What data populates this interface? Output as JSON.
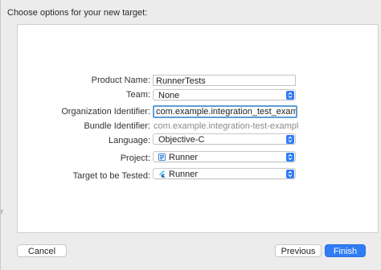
{
  "window": {
    "title": "Choose options for your new target:"
  },
  "form": {
    "product_name": {
      "label": "Product Name:",
      "value": "RunnerTests"
    },
    "team": {
      "label": "Team:",
      "value": "None"
    },
    "org_identifier": {
      "label": "Organization Identifier:",
      "value": "com.example.integration_test_example"
    },
    "bundle_identifier": {
      "label": "Bundle Identifier:",
      "value": "com.example.integration-test-example.RunnerT..."
    },
    "language": {
      "label": "Language:",
      "value": "Objective-C"
    },
    "project": {
      "label": "Project:",
      "value": "Runner",
      "icon": "xcode-project-icon"
    },
    "target_to_test": {
      "label": "Target to be Tested:",
      "value": "Runner",
      "icon": "flutter-app-icon"
    }
  },
  "buttons": {
    "cancel": "Cancel",
    "previous": "Previous",
    "finish": "Finish"
  },
  "colors": {
    "accent": "#2f7cf6",
    "focus_ring": "#5e9ed6"
  }
}
